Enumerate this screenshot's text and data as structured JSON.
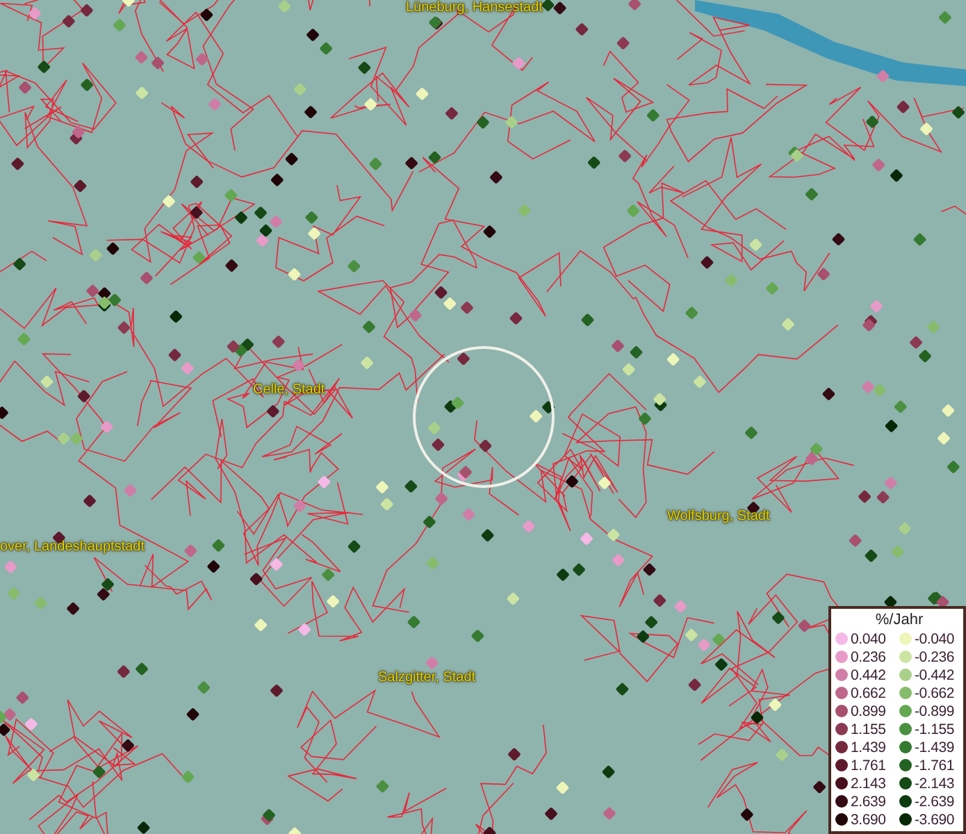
{
  "map": {
    "place_labels": [
      {
        "text": "Lüneburg, Hansestadt"
      },
      {
        "text": "Celle, Stadt"
      },
      {
        "text": "Wolfsburg, Stadt"
      },
      {
        "text": "over, Landeshauptstadt"
      },
      {
        "text": "Salzgitter, Stadt"
      }
    ]
  },
  "legend": {
    "title": "%/Jahr",
    "entries": [
      {
        "label": "0.040",
        "color": "#f6b8e6"
      },
      {
        "label": "-0.040",
        "color": "#eef5b8"
      },
      {
        "label": "0.236",
        "color": "#e89ac8"
      },
      {
        "label": "-0.236",
        "color": "#cce4a2"
      },
      {
        "label": "0.442",
        "color": "#d07ea8"
      },
      {
        "label": "-0.442",
        "color": "#a8d08a"
      },
      {
        "label": "0.662",
        "color": "#c0668a"
      },
      {
        "label": "-0.662",
        "color": "#86bc6c"
      },
      {
        "label": "0.899",
        "color": "#a8506e"
      },
      {
        "label": "-0.899",
        "color": "#64a852"
      },
      {
        "label": "1.155",
        "color": "#8c3a52"
      },
      {
        "label": "-1.155",
        "color": "#4a9040"
      },
      {
        "label": "1.439",
        "color": "#76283e"
      },
      {
        "label": "-1.439",
        "color": "#357a30"
      },
      {
        "label": "1.761",
        "color": "#5e1a2c"
      },
      {
        "label": "-1.761",
        "color": "#246222"
      },
      {
        "label": "2.143",
        "color": "#48101e"
      },
      {
        "label": "-2.143",
        "color": "#164a16"
      },
      {
        "label": "2.639",
        "color": "#340a14"
      },
      {
        "label": "-2.639",
        "color": "#0e3a10"
      },
      {
        "label": "3.690",
        "color": "#200408"
      },
      {
        "label": "-3.690",
        "color": "#062806"
      }
    ]
  }
}
